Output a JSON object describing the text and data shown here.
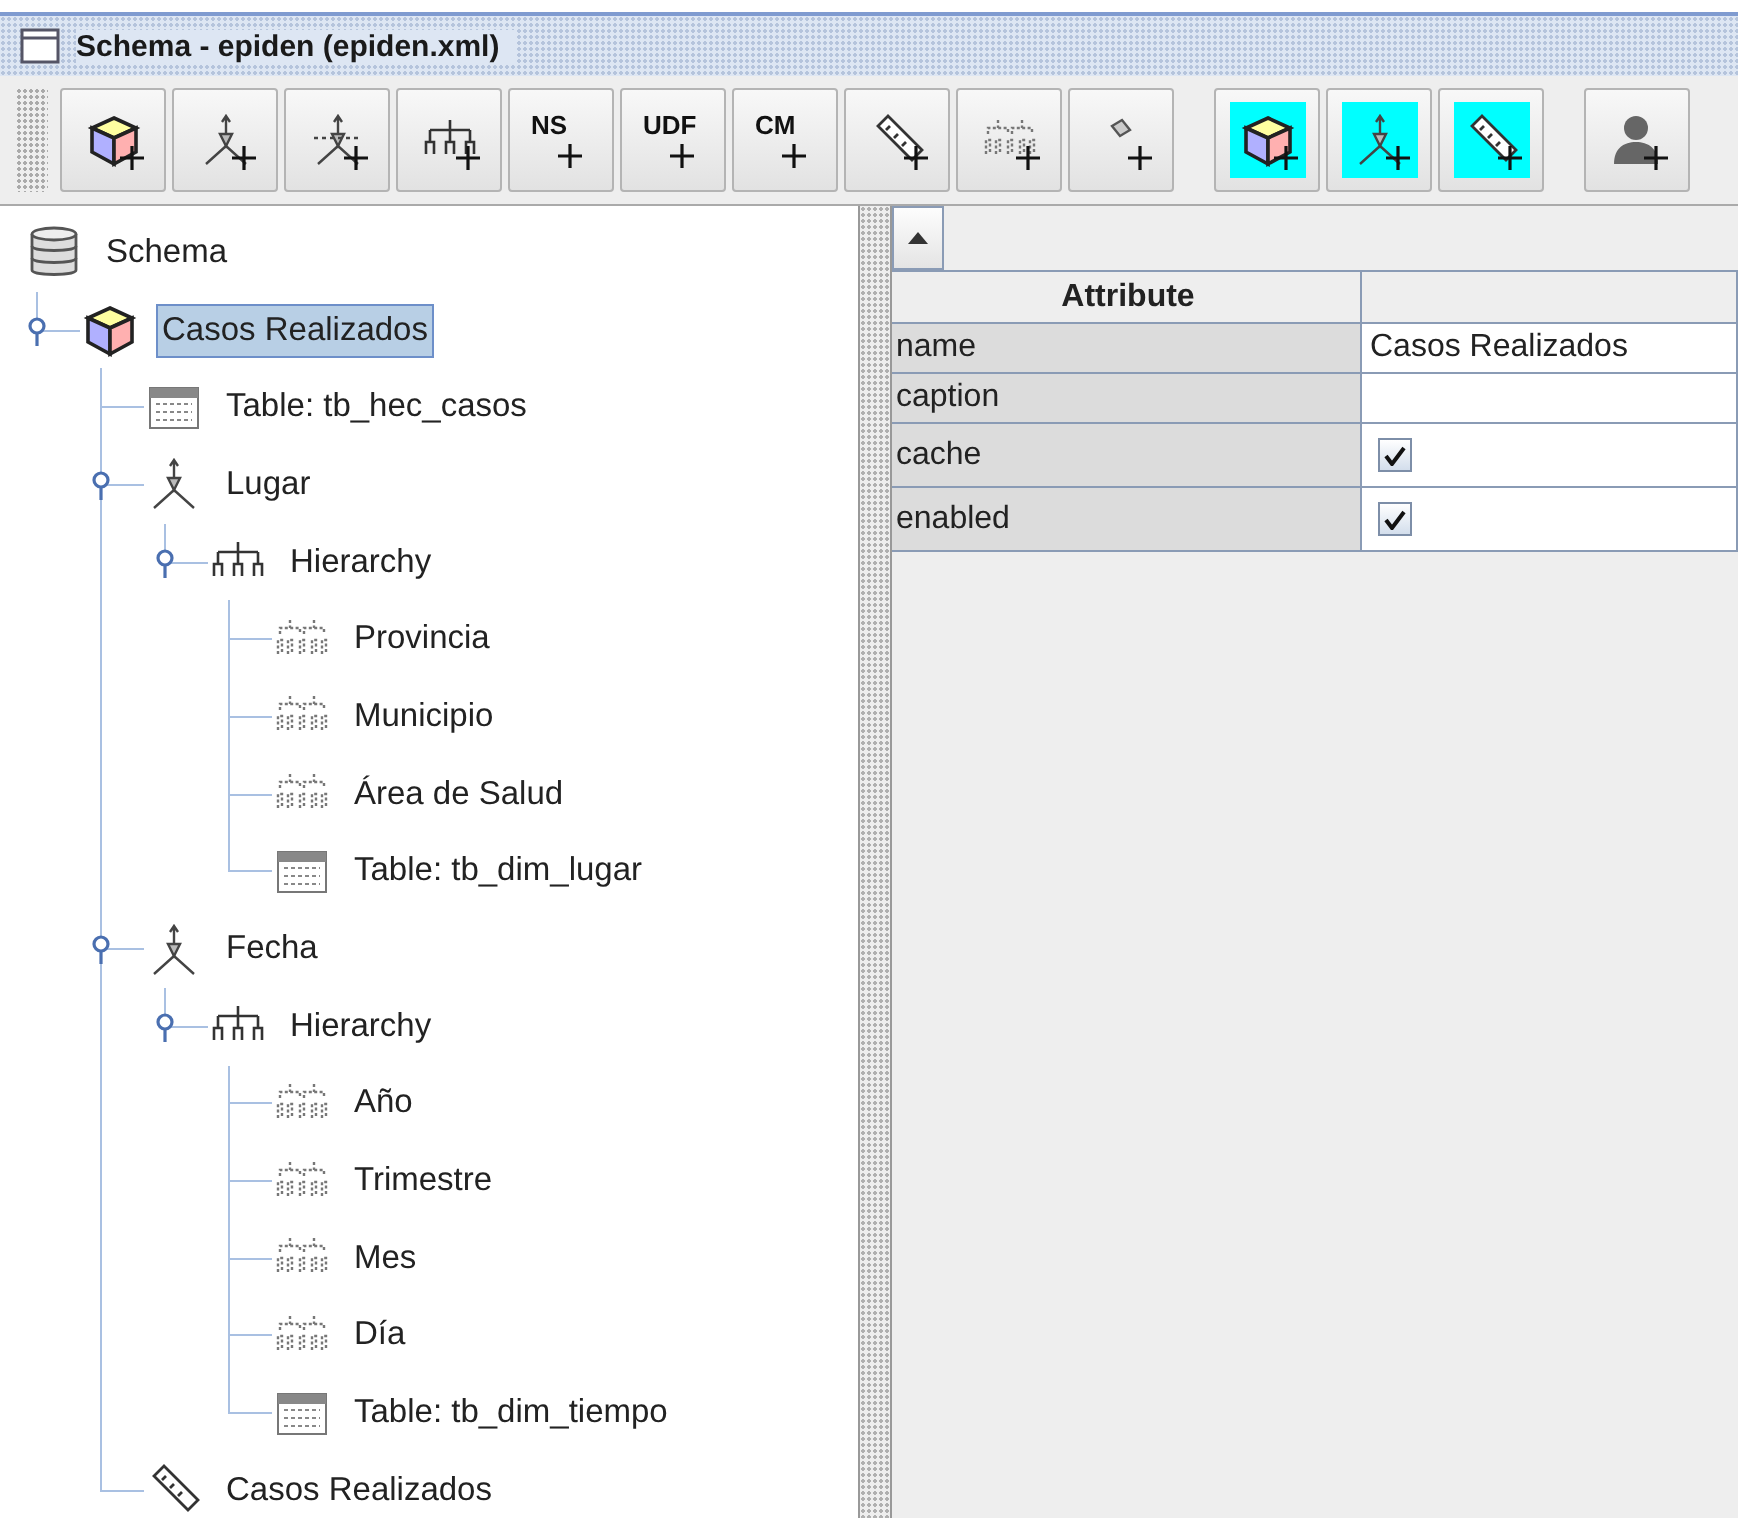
{
  "window": {
    "title": "Schema - epiden (epiden.xml)"
  },
  "toolbar": [
    {
      "kind": "cube",
      "highlighted": false
    },
    {
      "kind": "dimension",
      "highlighted": false
    },
    {
      "kind": "dimension-usage",
      "highlighted": false
    },
    {
      "kind": "hierarchy",
      "highlighted": false
    },
    {
      "kind": "text",
      "label": "NS",
      "highlighted": false
    },
    {
      "kind": "text",
      "label": "UDF",
      "highlighted": false
    },
    {
      "kind": "text",
      "label": "CM",
      "highlighted": false
    },
    {
      "kind": "measure",
      "highlighted": false
    },
    {
      "kind": "level",
      "highlighted": false
    },
    {
      "kind": "property",
      "highlighted": false
    },
    {
      "kind": "cube",
      "highlighted": true
    },
    {
      "kind": "dimension",
      "highlighted": true
    },
    {
      "kind": "measure",
      "highlighted": true
    },
    {
      "kind": "role",
      "highlighted": false
    }
  ],
  "tree": {
    "kind": "schema",
    "label": "Schema",
    "selected": false,
    "children": [
      {
        "kind": "cube",
        "label": "Casos Realizados",
        "selected": true,
        "expanded": true,
        "children": [
          {
            "kind": "table",
            "label": "Table: tb_hec_casos",
            "selected": false
          },
          {
            "kind": "dimension",
            "label": "Lugar",
            "selected": false,
            "expanded": true,
            "children": [
              {
                "kind": "hierarchy",
                "label": "Hierarchy",
                "selected": false,
                "expanded": true,
                "children": [
                  {
                    "kind": "level",
                    "label": "Provincia",
                    "selected": false
                  },
                  {
                    "kind": "level",
                    "label": "Municipio",
                    "selected": false
                  },
                  {
                    "kind": "level",
                    "label": "Área de Salud",
                    "selected": false
                  },
                  {
                    "kind": "table",
                    "label": "Table: tb_dim_lugar",
                    "selected": false
                  }
                ]
              }
            ]
          },
          {
            "kind": "dimension",
            "label": "Fecha",
            "selected": false,
            "expanded": true,
            "children": [
              {
                "kind": "hierarchy",
                "label": "Hierarchy",
                "selected": false,
                "expanded": true,
                "children": [
                  {
                    "kind": "level",
                    "label": "Año",
                    "selected": false
                  },
                  {
                    "kind": "level",
                    "label": "Trimestre",
                    "selected": false
                  },
                  {
                    "kind": "level",
                    "label": "Mes",
                    "selected": false
                  },
                  {
                    "kind": "level",
                    "label": "Día",
                    "selected": false
                  },
                  {
                    "kind": "table",
                    "label": "Table: tb_dim_tiempo",
                    "selected": false
                  }
                ]
              }
            ]
          },
          {
            "kind": "measure",
            "label": "Casos Realizados",
            "selected": false
          }
        ]
      }
    ]
  },
  "properties": {
    "columns": [
      "Attribute"
    ],
    "rows": [
      {
        "kind": "text",
        "attribute": "name",
        "value": "Casos Realizados"
      },
      {
        "kind": "text",
        "attribute": "caption"
      },
      {
        "kind": "checkbox",
        "attribute": "cache",
        "checked": true
      },
      {
        "kind": "checkbox",
        "attribute": "enabled",
        "checked": true
      }
    ]
  }
}
